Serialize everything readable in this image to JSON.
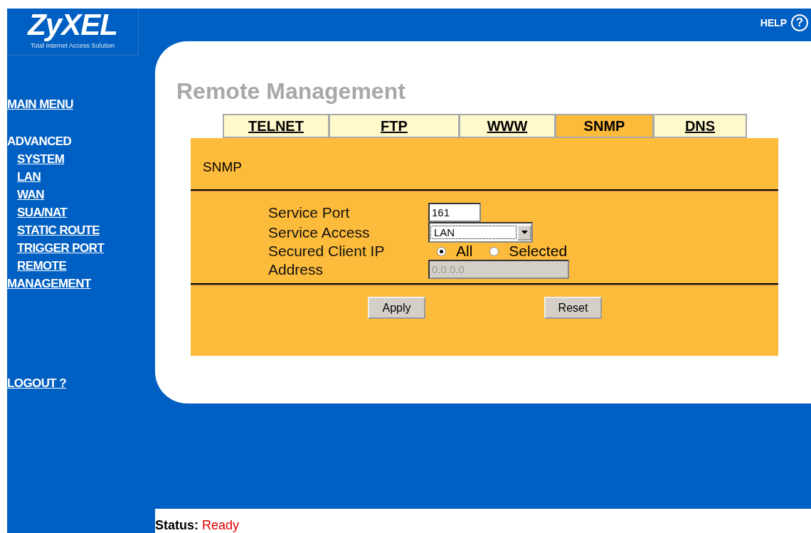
{
  "logo": {
    "name": "ZyXEL",
    "tagline": "Total Internet Access Solution"
  },
  "help": {
    "label": "HELP",
    "icon": "?"
  },
  "sidebar": {
    "items": [
      {
        "kind": "link",
        "label": "MAIN MENU"
      },
      {
        "kind": "heading",
        "label": "ADVANCED",
        "children": [
          {
            "label": "SYSTEM"
          },
          {
            "label": "LAN"
          },
          {
            "label": "WAN"
          },
          {
            "label": "SUA/NAT"
          },
          {
            "label": "STATIC ROUTE"
          },
          {
            "label": "TRIGGER PORT"
          },
          {
            "label": "REMOTE MANAGEMENT"
          }
        ]
      },
      {
        "kind": "logout",
        "label": "LOGOUT ?"
      }
    ]
  },
  "page": {
    "title": "Remote Management"
  },
  "tabs": [
    {
      "label": "TELNET",
      "selected": false
    },
    {
      "label": "FTP",
      "selected": false
    },
    {
      "label": "WWW",
      "selected": false
    },
    {
      "label": "SNMP",
      "selected": true
    },
    {
      "label": "DNS",
      "selected": false
    }
  ],
  "panel": {
    "heading": "SNMP",
    "fields": [
      {
        "kind": "text",
        "label": "Service Port",
        "value": "161"
      },
      {
        "kind": "select",
        "label": "Service Access",
        "value": "LAN"
      },
      {
        "kind": "radio",
        "label": "Secured Client IP",
        "options": [
          {
            "label": "All",
            "selected": true
          },
          {
            "label": "Selected",
            "selected": false
          }
        ]
      },
      {
        "kind": "text",
        "label": "Address",
        "value": "0.0.0.0",
        "disabled": true
      }
    ],
    "buttons": [
      "Apply",
      "Reset"
    ]
  },
  "status": {
    "label": "Status:",
    "value": "Ready"
  }
}
